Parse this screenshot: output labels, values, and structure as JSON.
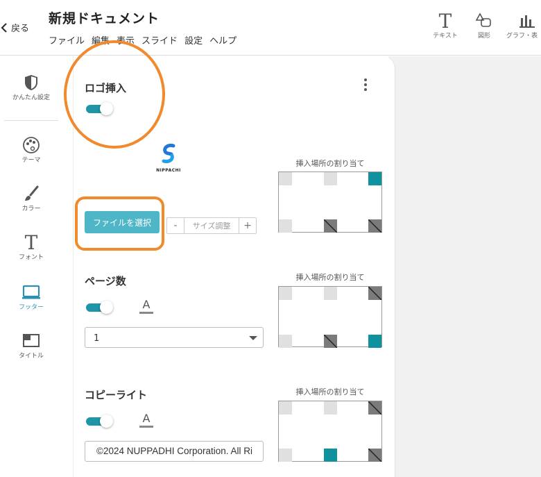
{
  "header": {
    "back_label": "戻る",
    "title": "新規ドキュメント",
    "menu": [
      "ファイル",
      "編集",
      "表示",
      "スライド",
      "設定",
      "ヘルプ"
    ],
    "tools": [
      {
        "label": "テキスト",
        "icon": "text-icon"
      },
      {
        "label": "図形",
        "icon": "shape-icon"
      },
      {
        "label": "グラフ・表",
        "icon": "chart-icon"
      }
    ]
  },
  "sidebar": {
    "items": [
      {
        "label": "かんたん設定",
        "icon": "shield-icon"
      },
      {
        "label": "テーマ",
        "icon": "palette-icon"
      },
      {
        "label": "カラー",
        "icon": "brush-icon"
      },
      {
        "label": "フォント",
        "icon": "font-icon"
      },
      {
        "label": "フッター",
        "icon": "monitor-icon",
        "active": true
      },
      {
        "label": "タイトル",
        "icon": "title-window-icon"
      }
    ]
  },
  "panel": {
    "logo_section": {
      "title": "ロゴ挿入",
      "toggle_on": true,
      "logo_text": "NIPPACHI",
      "file_button": "ファイルを選択",
      "size_minus": "-",
      "size_label": "サイズ調整",
      "size_plus": "+",
      "assign_label": "挿入場所の割り当て"
    },
    "page_section": {
      "title": "ページ数",
      "toggle_on": true,
      "font_label": "A",
      "select_value": "1",
      "assign_label": "挿入場所の割り当て"
    },
    "copyright_section": {
      "title": "コピーライト",
      "toggle_on": true,
      "font_label": "A",
      "input_value": "©2024 NUPPADHI Corporation. All Ri",
      "assign_label": "挿入場所の割り当て"
    }
  },
  "colors": {
    "accent": "#1e95a8",
    "active_cell": "#10929e",
    "highlight": "#f08a2c",
    "button": "#4fb6c8"
  }
}
